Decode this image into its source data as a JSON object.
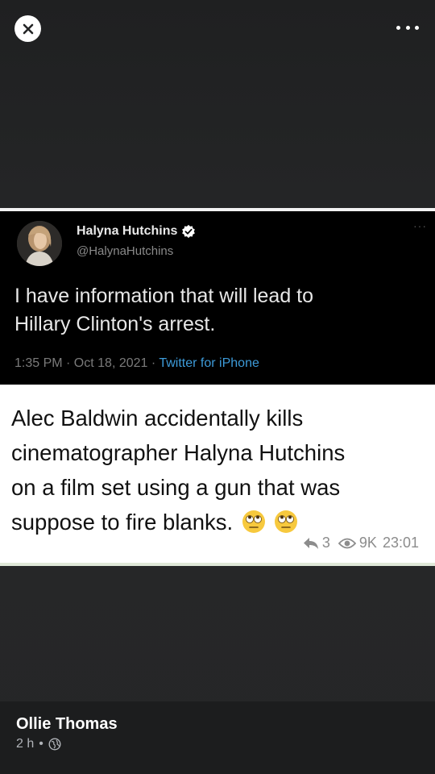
{
  "viewer": {
    "close_icon": "close-icon",
    "more_icon": "more-options-icon"
  },
  "tweet": {
    "name": "Halyna Hutchins",
    "handle": "@HalynaHutchins",
    "verified_icon": "verified-badge-icon",
    "text_line1": "I have information that will lead to",
    "text_line2": "Hillary Clinton's arrest.",
    "timestamp": "1:35 PM · Oct 18, 2021 · ",
    "source": "Twitter for iPhone",
    "more_label": "···"
  },
  "caption": {
    "line1": "Alec Baldwin accidentally kills",
    "line2": "cinematographer Halyna Hutchins",
    "line3": "on a film set using a gun that was",
    "line4": "suppose to fire blanks.",
    "emoji": "rolling-eyes-emoji",
    "reply_count": "3",
    "views": "9K",
    "time": "23:01"
  },
  "footer": {
    "poster_name": "Ollie Thomas",
    "age": "2 h",
    "privacy_icon": "globe-icon"
  },
  "colors": {
    "background": "#242526",
    "tweet_link": "#3d9bd9",
    "verified": "#ffffff"
  }
}
